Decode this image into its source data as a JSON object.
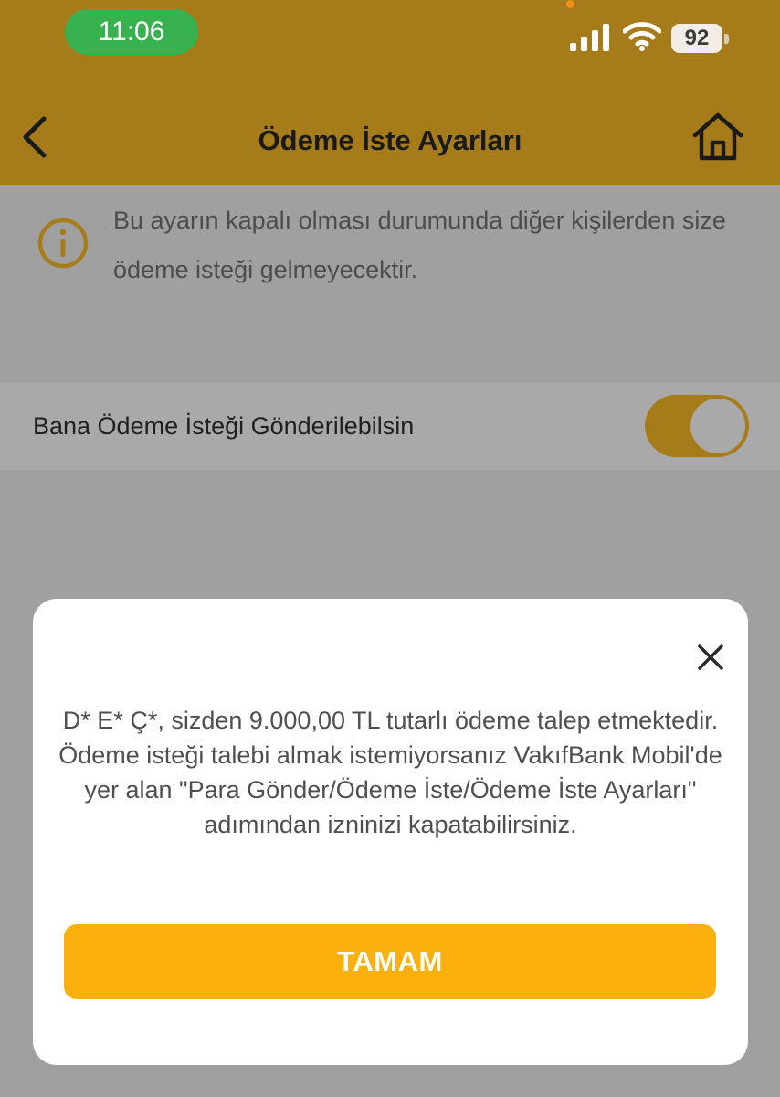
{
  "status_bar": {
    "time": "11:06",
    "battery": "92",
    "signal_icon": "cellular-signal-icon",
    "wifi_icon": "wifi-icon",
    "battery_icon": "battery-icon"
  },
  "header": {
    "title": "Ödeme İste Ayarları",
    "back_icon": "chevron-left-icon",
    "home_icon": "home-icon",
    "color": "#a67c1a"
  },
  "info": {
    "icon": "info-icon",
    "text": "Bu ayarın kapalı olması durumunda diğer kişilerden size ödeme isteği gelmeyecektir."
  },
  "setting": {
    "label": "Bana Ödeme İsteği Gönderilebilsin",
    "enabled": true
  },
  "modal": {
    "close_icon": "close-icon",
    "message": "D* E* Ç*, sizden 9.000,00 TL tutarlı ödeme talep etmektedir. Ödeme isteği talebi almak istemiyorsanız VakıfBank Mobil'de yer alan \"Para Gönder/Ödeme İste/Ödeme İste Ayarları\" adımından izninizi kapatabilirsiniz.",
    "button_label": "TAMAM",
    "button_color": "#fbb00d"
  }
}
